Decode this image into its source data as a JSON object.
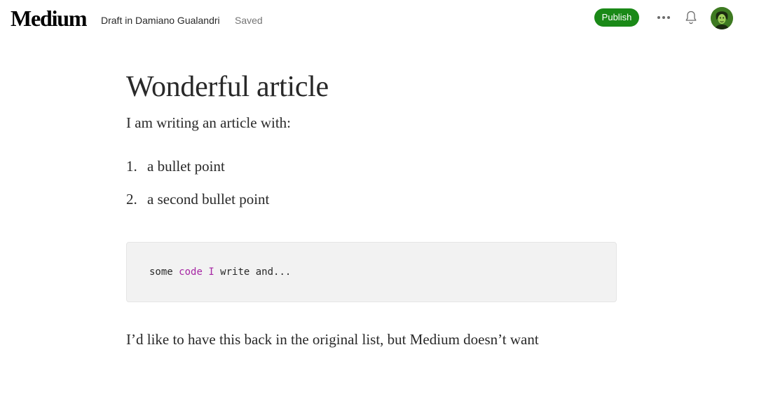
{
  "header": {
    "logo": "Medium",
    "draft_info": "Draft in Damiano Gualandri",
    "status": "Saved",
    "publish_label": "Publish",
    "icons": [
      "more-icon",
      "bell-icon",
      "avatar"
    ],
    "accent_color": "#1a8917"
  },
  "article": {
    "title": "Wonderful article",
    "intro": "I am writing an article with:",
    "list": [
      {
        "number": "1.",
        "text": "a bullet point"
      },
      {
        "number": "2.",
        "text": "a second bullet point"
      }
    ],
    "code": {
      "tokens": [
        {
          "text": "some ",
          "kind": "plain"
        },
        {
          "text": "code",
          "kind": "keyword"
        },
        {
          "text": " ",
          "kind": "plain"
        },
        {
          "text": "I",
          "kind": "keyword"
        },
        {
          "text": " write and...",
          "kind": "plain"
        }
      ],
      "keyword_color": "#a626a4",
      "background_color": "#f2f2f2"
    },
    "outro": "I’d like to have this back in the original list, but Medium doesn’t want"
  }
}
